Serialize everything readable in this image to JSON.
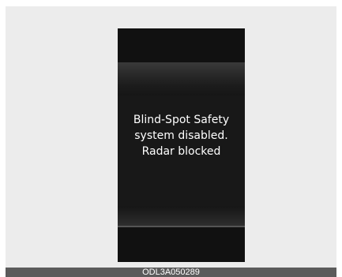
{
  "display": {
    "message_line1": "Blind-Spot Safety",
    "message_line2": "system disabled.",
    "message_line3": "Radar blocked"
  },
  "caption": {
    "code": "ODL3A050289"
  }
}
